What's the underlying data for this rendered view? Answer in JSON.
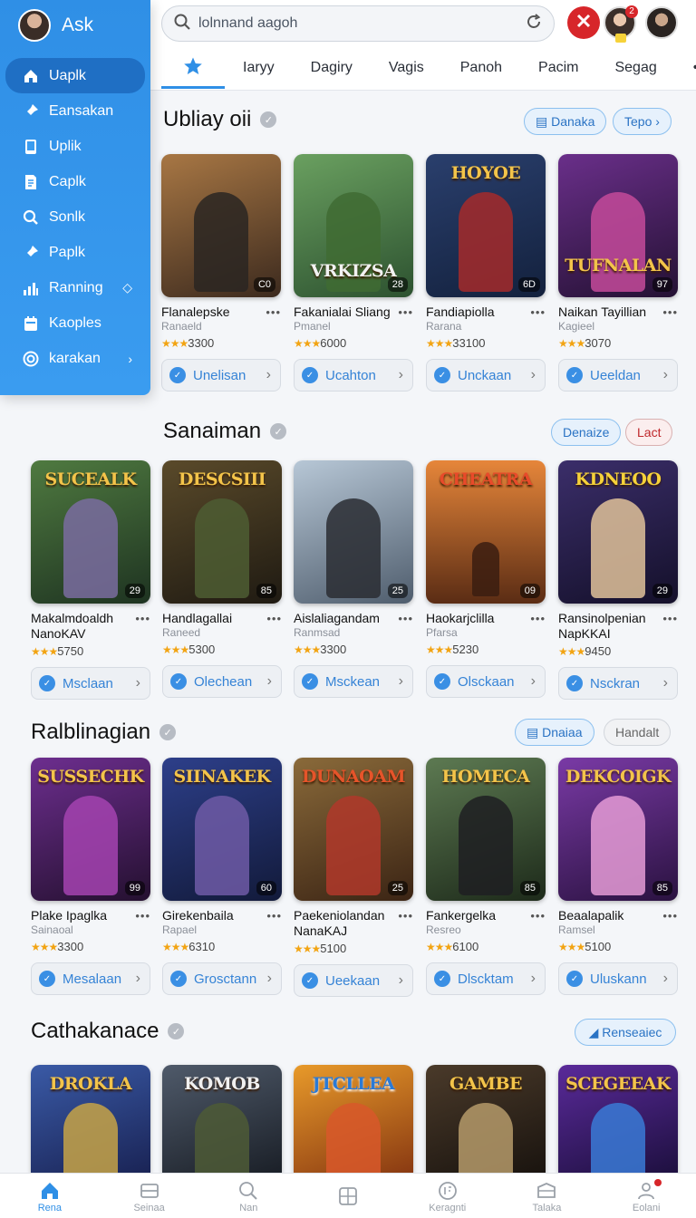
{
  "sidebar": {
    "title": "Ask",
    "items": [
      {
        "label": "Uaplk",
        "icon": "home-icon",
        "active": true
      },
      {
        "label": "Eansakan",
        "icon": "pin-icon"
      },
      {
        "label": "Uplik",
        "icon": "tablet-icon"
      },
      {
        "label": "Caplk",
        "icon": "document-icon"
      },
      {
        "label": "Sonlk",
        "icon": "search-icon"
      },
      {
        "label": "Paplk",
        "icon": "pin-icon"
      },
      {
        "label": "Ranning",
        "icon": "bar-chart-icon",
        "tail": "◇"
      },
      {
        "label": "Kaoples",
        "icon": "calendar-icon"
      },
      {
        "label": "karakan",
        "icon": "target-icon",
        "tail": "›"
      }
    ]
  },
  "header": {
    "search_value": "lolnnand aagoh",
    "badge_count": "2",
    "tabs": [
      "Iaryy",
      "Dagiry",
      "Vagis",
      "Panoh",
      "Pacim",
      "Segag",
      "•••"
    ]
  },
  "sections": [
    {
      "title": "Ubliay oii",
      "pills": [
        "Danaka",
        "Tepo ›"
      ],
      "games": [
        {
          "title": "Flanalepske",
          "sub": "Ranaeld",
          "rating": "3300",
          "action": "Unelisan",
          "badge": "C0",
          "logo": ""
        },
        {
          "title": "Fakanialai Sliang",
          "sub": "Pmanel",
          "rating": "6000",
          "action": "Ucahton",
          "badge": "28",
          "logo": "VRKIZSA"
        },
        {
          "title": "Fandiapiolla",
          "sub": "Rarana",
          "rating": "33100",
          "action": "Unckaan",
          "badge": "6D",
          "logo": "HOYOE"
        },
        {
          "title": "Naikan Tayillian",
          "sub": "Kagieel",
          "rating": "3070",
          "action": "Ueeldan",
          "badge": "97",
          "logo": "TUFNALAN"
        }
      ]
    },
    {
      "title": "Sanaiman",
      "pills": [
        "Denaize",
        "Lact"
      ],
      "games": [
        {
          "title": "Makalmdoaldh NanoKAV",
          "sub": "",
          "rating": "5750",
          "action": "Msclaan",
          "badge": "29",
          "logo": "SUCEALK"
        },
        {
          "title": "Handlagallai",
          "sub": "Raneed",
          "rating": "5300",
          "action": "Olechean",
          "badge": "85",
          "logo": "DESCSIII"
        },
        {
          "title": "Aislaliagandam",
          "sub": "Ranmsad",
          "rating": "3300",
          "action": "Msckean",
          "badge": "25",
          "logo": ""
        },
        {
          "title": "Haokarjclilla",
          "sub": "Pfarsa",
          "rating": "5230",
          "action": "Olsckaan",
          "badge": "09",
          "logo": "CHEATRA"
        },
        {
          "title": "Ransinolpenian NapKKAI",
          "sub": "",
          "rating": "9450",
          "action": "Nsckran",
          "badge": "29",
          "logo": "KDNEOO"
        }
      ]
    },
    {
      "title": "Ralblinagian",
      "pills": [
        "Dnaiaa",
        "Handalt"
      ],
      "games": [
        {
          "title": "Plake Ipaglka",
          "sub": "Sainaoal",
          "rating": "3300",
          "action": "Mesalaan",
          "badge": "99",
          "logo": "SUSSECHK"
        },
        {
          "title": "Girekenbaila",
          "sub": "Rapael",
          "rating": "6310",
          "action": "Grosctann",
          "badge": "60",
          "logo": "SIINAKEK"
        },
        {
          "title": "Paekeniolandan NanaKAJ",
          "sub": "",
          "rating": "5100",
          "action": "Ueekaan",
          "badge": "25",
          "logo": "DUNAOAM"
        },
        {
          "title": "Fankergelka",
          "sub": "Resreo",
          "rating": "6100",
          "action": "Dlscktam",
          "badge": "85",
          "logo": "HOMECA"
        },
        {
          "title": "Beaalapalik",
          "sub": "Ramsel",
          "rating": "5100",
          "action": "Uluskann",
          "badge": "85",
          "logo": "DEKCOIGK"
        }
      ]
    },
    {
      "title": "Cathakanace",
      "pills": [
        "Renseaiec"
      ],
      "games": [
        {
          "logo": "DROKLA"
        },
        {
          "logo": "KOMOB"
        },
        {
          "logo": "JTCLLEA"
        },
        {
          "logo": "GAMBE"
        },
        {
          "logo": "SCEGEEAK"
        }
      ]
    }
  ],
  "bottom_nav": [
    {
      "label": "Rena",
      "icon": "home-icon",
      "active": true
    },
    {
      "label": "Seinaa",
      "icon": "inbox-icon"
    },
    {
      "label": "Nan",
      "icon": "search-icon"
    },
    {
      "label": "",
      "icon": "grid-icon"
    },
    {
      "label": "Keragnti",
      "icon": "badge-icon"
    },
    {
      "label": "Talaka",
      "icon": "box-icon"
    },
    {
      "label": "Eolani",
      "icon": "user-icon"
    }
  ]
}
